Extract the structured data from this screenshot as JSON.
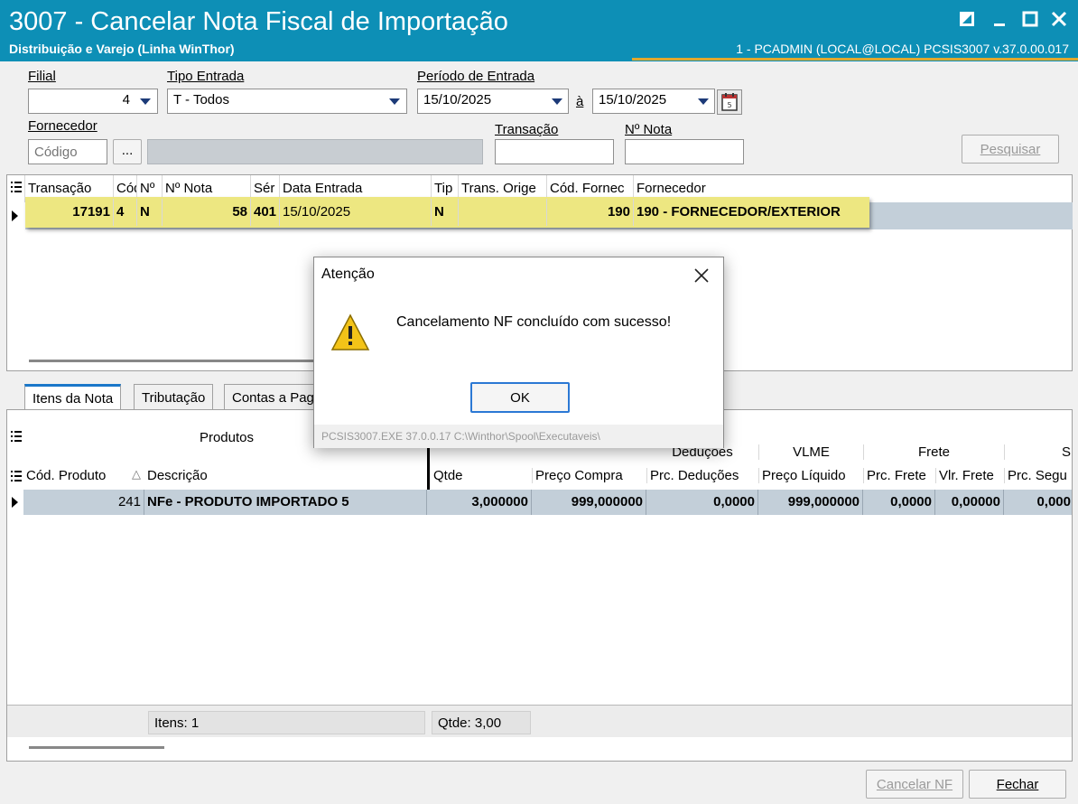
{
  "window": {
    "title": "3007 - Cancelar Nota Fiscal de Importação",
    "subtitle": "Distribuição e Varejo (Linha WinThor)",
    "session": "1 - PCADMIN (LOCAL@LOCAL)   PCSIS3007  v.37.0.00.017"
  },
  "form": {
    "filial_label": "Filial",
    "filial_value": "4",
    "tipo_entrada_label": "Tipo Entrada",
    "tipo_entrada_value": "T - Todos",
    "periodo_label": "Período de Entrada",
    "periodo_inicio": "15/10/2025",
    "periodo_sep": "à",
    "periodo_fim": "15/10/2025",
    "fornecedor_label": "Fornecedor",
    "fornecedor_codigo_placeholder": "Código",
    "ellipsis_label": "...",
    "transacao_label": "Transação",
    "transacao_value": "",
    "nota_label": "Nº Nota",
    "nota_value": "",
    "pesquisar_label": "Pesquisar"
  },
  "grid1": {
    "headers": [
      "Transação",
      "Cód",
      "Nº",
      "Nº Nota",
      "Sér",
      "Data Entrada",
      "Tip",
      "Trans. Orige",
      "Cód. Fornec",
      "Fornecedor"
    ],
    "row": {
      "transacao": "17191",
      "cod": "4",
      "n": "N",
      "nota": "58",
      "serie": "401",
      "data_entrada": "15/10/2025",
      "tipo": "N",
      "trans_origem": "",
      "cod_fornec": "190",
      "fornecedor": "190 - FORNECEDOR/EXTERIOR"
    }
  },
  "tabs": [
    "Itens da Nota",
    "Tributação",
    "Contas a Pagar"
  ],
  "grid2": {
    "group_produtos": "Produtos",
    "group_deducoes": "Deduções",
    "group_vlme": "VLME",
    "group_frete": "Frete",
    "group_seguro": "S",
    "headers": [
      "Cód. Produto",
      "Descrição",
      "Qtde",
      "Preço Compra",
      "Prc. Deduções",
      "Preço Líquido",
      "Prc. Frete",
      "Vlr. Frete",
      "Prc. Segu"
    ],
    "row": {
      "cod_produto": "241",
      "descricao": "NFe - PRODUTO IMPORTADO 5",
      "qtde": "3,000000",
      "preco_compra": "999,000000",
      "prc_deducoes": "0,0000",
      "preco_liquido": "999,000000",
      "prc_frete": "0,0000",
      "vlr_frete": "0,00000",
      "prc_seguro": "0,000"
    },
    "footer_itens": "Itens: 1",
    "footer_qtde": "Qtde: 3,00"
  },
  "buttons": {
    "cancelar_nf": "Cancelar NF",
    "fechar": "Fechar"
  },
  "dialog": {
    "title": "Atenção",
    "message": "Cancelamento NF concluído com sucesso!",
    "ok_label": "OK",
    "footer": "PCSIS3007.EXE 37.0.0.17 C:\\Winthor\\Spool\\Executaveis\\"
  },
  "colors": {
    "titlebar": "#0d8fb6",
    "title_accent": "#e0a82e",
    "row_highlight": "#ede781",
    "row_selected": "#c3cfd9",
    "tab_active": "#1a77c9",
    "warning": "#f3c318"
  }
}
